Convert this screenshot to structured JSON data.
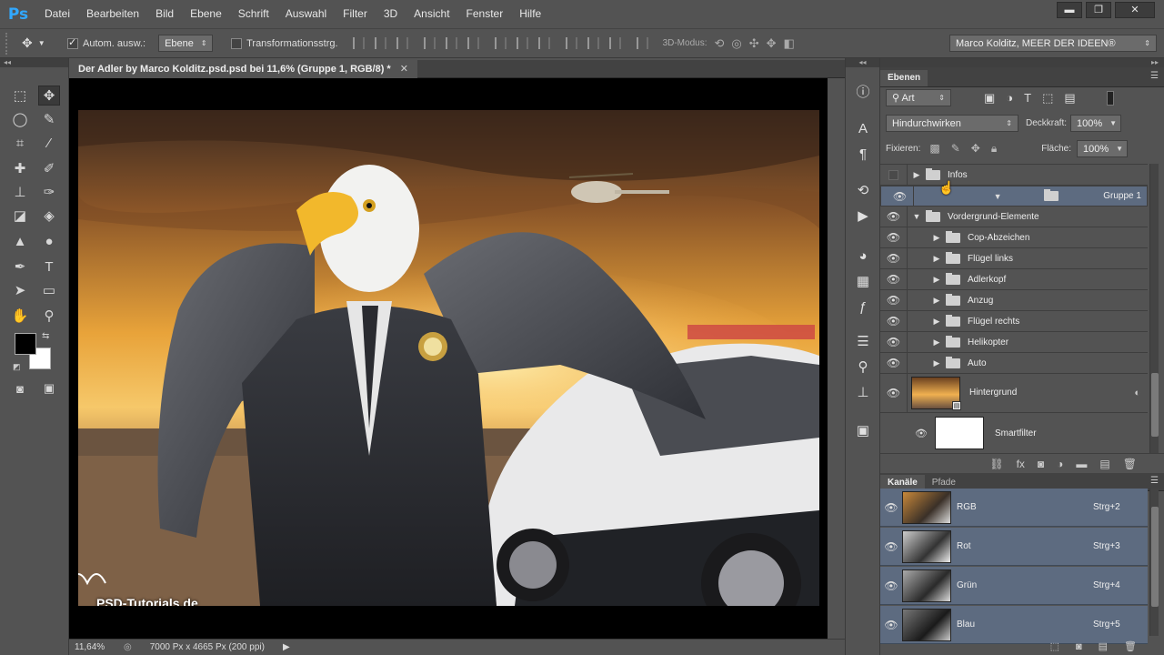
{
  "menubar": {
    "logo": "Ps",
    "items": [
      "Datei",
      "Bearbeiten",
      "Bild",
      "Ebene",
      "Schrift",
      "Auswahl",
      "Filter",
      "3D",
      "Ansicht",
      "Fenster",
      "Hilfe"
    ],
    "min": "▬",
    "max": "❐",
    "close": "✕"
  },
  "options": {
    "auto_select_label": "Autom. ausw.:",
    "auto_select_value": "Ebene",
    "transform_label": "Transformationsstrg.",
    "mode3d_label": "3D-Modus:",
    "workspace": "Marco Kolditz, MEER DER IDEEN®"
  },
  "document": {
    "tab_title": "Der Adler by Marco Kolditz.psd.psd bei 11,6% (Gruppe 1, RGB/8) *",
    "close": "✕",
    "watermark": "PSD-Tutorials.de"
  },
  "status": {
    "zoom": "11,64%",
    "info": "7000 Px x 4665 Px (200 ppi)"
  },
  "layers_panel": {
    "tab": "Ebenen",
    "filter_label": "Art",
    "blend_mode": "Hindurchwirken",
    "opacity_label": "Deckkraft:",
    "opacity_value": "100%",
    "lock_label": "Fixieren:",
    "fill_label": "Fläche:",
    "fill_value": "100%",
    "layers": [
      {
        "name": "Infos",
        "visible": false,
        "expanded": false,
        "indent": 0,
        "selected": false
      },
      {
        "name": "Gruppe 1",
        "visible": true,
        "expanded": true,
        "indent": 0,
        "selected": true
      },
      {
        "name": "Vordergrund-Elemente",
        "visible": true,
        "expanded": true,
        "indent": 0,
        "selected": false
      },
      {
        "name": "Cop-Abzeichen",
        "visible": true,
        "expanded": false,
        "indent": 1,
        "selected": false
      },
      {
        "name": "Flügel links",
        "visible": true,
        "expanded": false,
        "indent": 1,
        "selected": false
      },
      {
        "name": "Adlerkopf",
        "visible": true,
        "expanded": false,
        "indent": 1,
        "selected": false
      },
      {
        "name": "Anzug",
        "visible": true,
        "expanded": false,
        "indent": 1,
        "selected": false
      },
      {
        "name": "Flügel rechts",
        "visible": true,
        "expanded": false,
        "indent": 1,
        "selected": false
      },
      {
        "name": "Helikopter",
        "visible": true,
        "expanded": false,
        "indent": 1,
        "selected": false
      },
      {
        "name": "Auto",
        "visible": true,
        "expanded": false,
        "indent": 1,
        "selected": false
      }
    ],
    "background_layer": "Hintergrund",
    "smartfilter": "Smartfilter"
  },
  "channels_panel": {
    "tabs": [
      "Kanäle",
      "Pfade"
    ],
    "channels": [
      {
        "name": "RGB",
        "shortcut": "Strg+2"
      },
      {
        "name": "Rot",
        "shortcut": "Strg+3"
      },
      {
        "name": "Grün",
        "shortcut": "Strg+4"
      },
      {
        "name": "Blau",
        "shortcut": "Strg+5"
      }
    ]
  }
}
